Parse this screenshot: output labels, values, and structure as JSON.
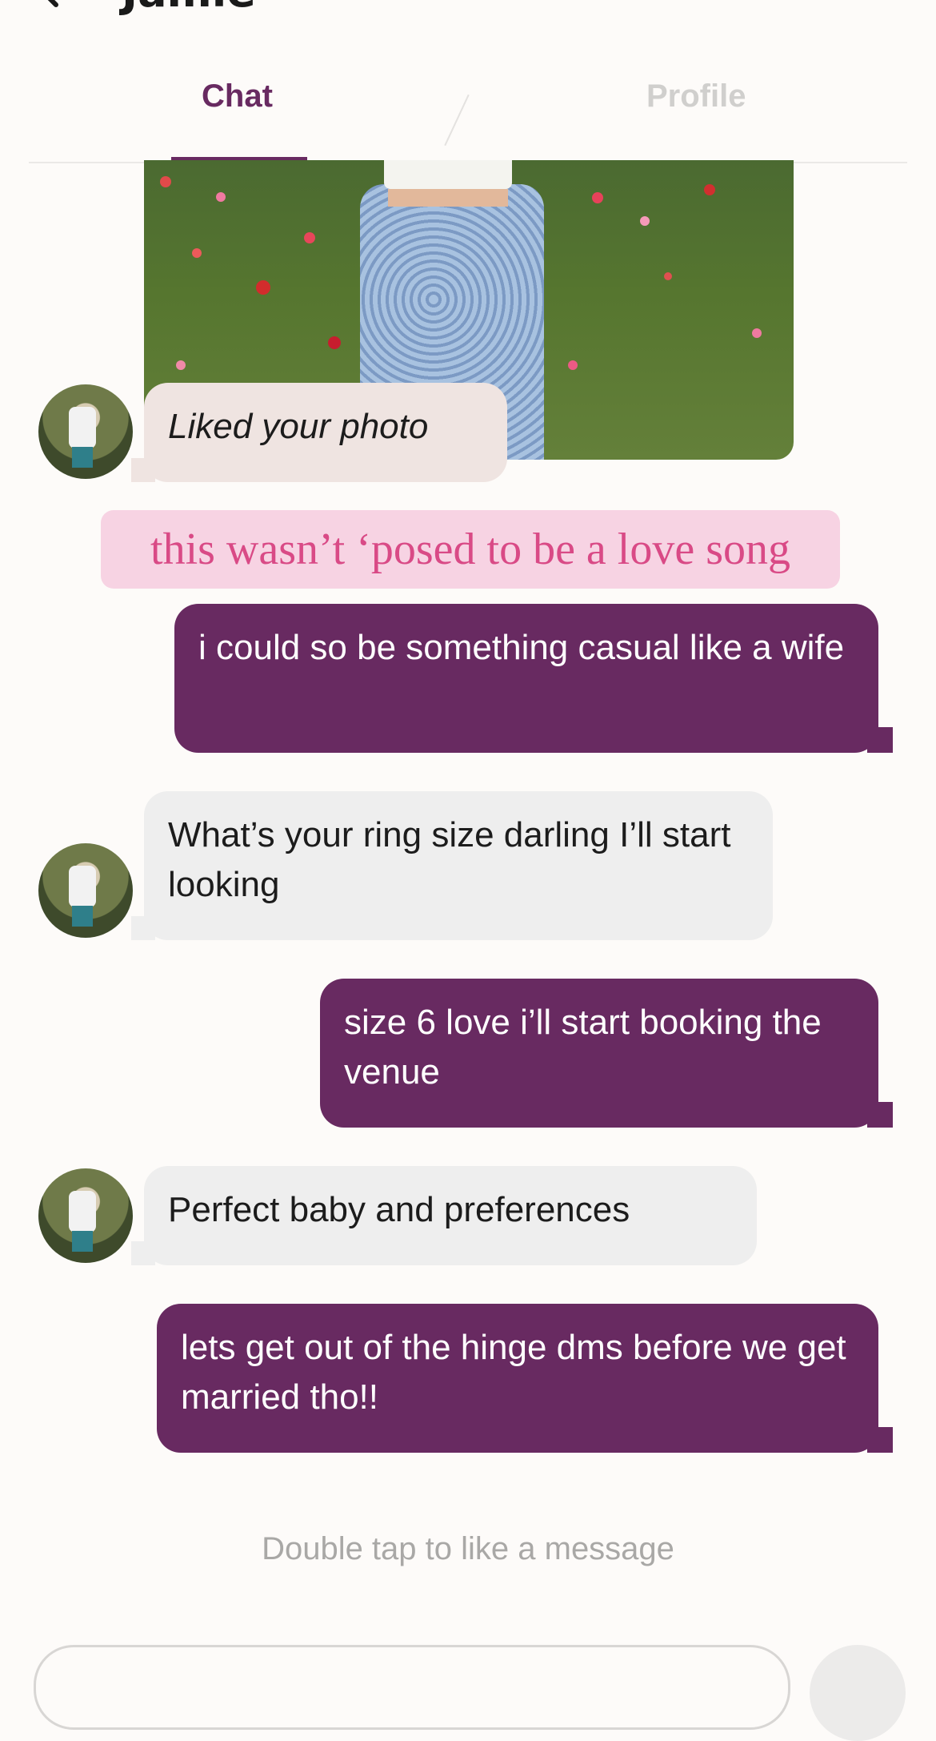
{
  "header": {
    "title": "Jamie"
  },
  "tabs": [
    {
      "label": "Chat"
    },
    {
      "label": "Profile"
    }
  ],
  "messages": [
    {
      "from": "them",
      "text": "Liked your photo"
    },
    {
      "from": "me",
      "text": "this wasn’t ‘posed to be a love song"
    },
    {
      "from": "me",
      "text": "i could so be something casual like a wife"
    },
    {
      "from": "them",
      "text": "What’s your ring size darling I’ll start looking"
    },
    {
      "from": "me",
      "text": "size 6 love i’ll start booking the venue"
    },
    {
      "from": "them",
      "text": "Perfect baby and preferences"
    },
    {
      "from": "me",
      "text": "lets get out of the hinge dms before we get married tho!!"
    }
  ],
  "hint": "Double tap to like a message",
  "colors": {
    "accent": "#682a61",
    "incoming": "#eeeeee",
    "quote_bg": "#f7d3e3",
    "quote_text": "#d94a86"
  },
  "icons": {
    "back": "chevron-left-icon"
  }
}
